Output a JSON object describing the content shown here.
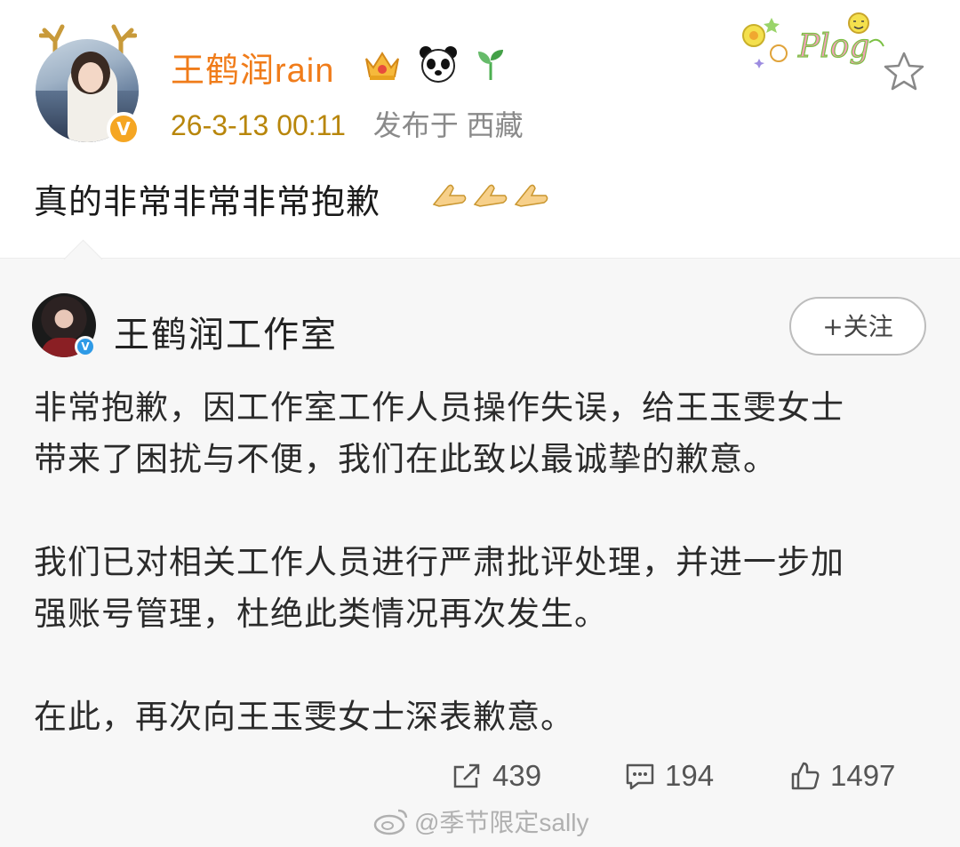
{
  "post": {
    "username": "王鹤润rain",
    "timestamp": "26-3-13 00:11",
    "location": "发布于 西藏",
    "text": "真的非常非常非常抱歉",
    "emoji_count": 3,
    "badges": [
      "crown-icon",
      "panda-icon",
      "sprout-icon"
    ],
    "sticker": "Plog"
  },
  "repost": {
    "author": "王鹤润工作室",
    "follow_label": "+关注",
    "paragraphs": [
      "非常抱歉，因工作室工作人员操作失误，给王玉雯女士",
      "带来了困扰与不便，我们在此致以最诚挚的歉意。",
      "",
      "我们已对相关工作人员进行严肃批评处理，并进一步加",
      "强账号管理，杜绝此类情况再次发生。",
      "",
      "在此，再次向王玉雯女士深表歉意。"
    ],
    "actions": {
      "share": "439",
      "comment": "194",
      "like": "1497"
    }
  },
  "watermark": "@季节限定sally",
  "colors": {
    "username": "#f07c1a",
    "verified_orange": "#f5a623",
    "verified_blue": "#2e9ae6",
    "repost_bg": "#f7f7f7"
  }
}
